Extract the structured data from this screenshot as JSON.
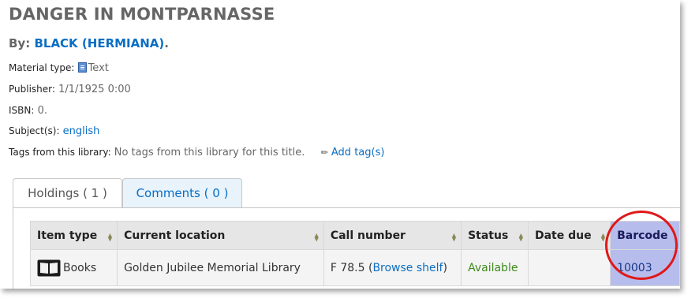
{
  "record": {
    "title": "DANGER IN MONTPARNASSE",
    "by_label": "By:",
    "author": "BLACK (HERMIANA)",
    "author_suffix": "."
  },
  "details": {
    "material_label": "Material type:",
    "material_value": "Text",
    "material_icon": "text-document-icon",
    "publisher_label": "Publisher:",
    "publisher_value": "1/1/1925 0:00",
    "isbn_label": "ISBN:",
    "isbn_value": "0.",
    "subjects_label": "Subject(s):",
    "subjects_value": "english",
    "tags_label": "Tags from this library:",
    "tags_value": "No tags from this library for this title.",
    "add_tags_label": "Add tag(s)"
  },
  "tabs": {
    "holdings": "Holdings ( 1 )",
    "comments": "Comments ( 0 )"
  },
  "holdings_table": {
    "columns": [
      "Item type",
      "Current location",
      "Call number",
      "Status",
      "Date due",
      "Barcode"
    ],
    "row": {
      "item_type": "Books",
      "item_type_icon": "book-icon",
      "location": "Golden Jubilee Memorial Library",
      "call_number": "F 78.5",
      "browse_label": "Browse shelf",
      "status": "Available",
      "date_due": "",
      "barcode": "10003"
    }
  },
  "colors": {
    "link": "#0a6ec4",
    "available": "#3d8a1b",
    "highlight": "#b6bcec",
    "annotation_circle": "#e01818"
  }
}
